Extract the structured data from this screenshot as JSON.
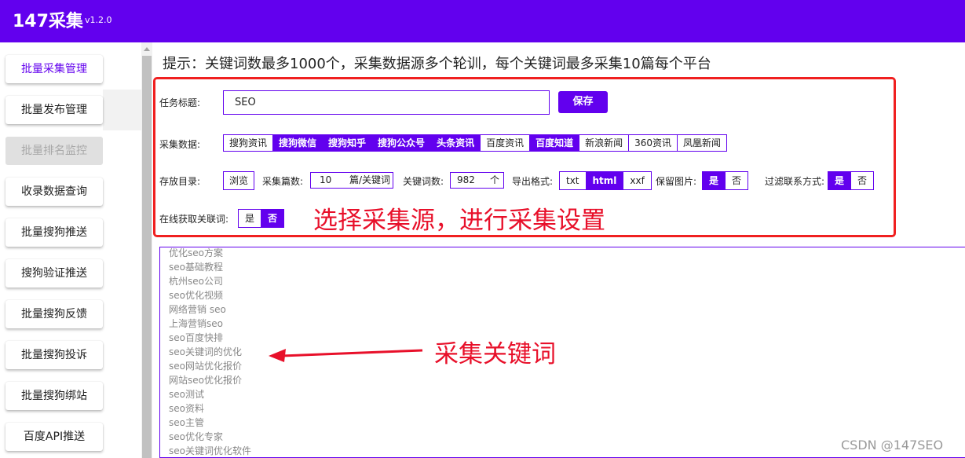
{
  "app": {
    "title": "147采集",
    "version": "v1.2.0"
  },
  "sidebar": {
    "items": [
      {
        "label": "批量采集管理",
        "state": "active"
      },
      {
        "label": "批量发布管理",
        "state": "normal"
      },
      {
        "label": "批量排名监控",
        "state": "disabled"
      },
      {
        "label": "收录数据查询",
        "state": "normal"
      },
      {
        "label": "批量搜狗推送",
        "state": "normal"
      },
      {
        "label": "搜狗验证推送",
        "state": "normal"
      },
      {
        "label": "批量搜狗反馈",
        "state": "normal"
      },
      {
        "label": "批量搜狗投诉",
        "state": "normal"
      },
      {
        "label": "批量搜狗绑站",
        "state": "normal"
      },
      {
        "label": "百度API推送",
        "state": "normal"
      }
    ]
  },
  "tip": "提示：关键词数最多1000个，采集数据源多个轮训，每个关键词最多采集10篇每个平台",
  "form": {
    "task_title_label": "任务标题:",
    "task_title_value": "SEO",
    "save_label": "保存",
    "source_label": "采集数据:",
    "sources": [
      {
        "label": "搜狗资讯",
        "on": false
      },
      {
        "label": "搜狗微信",
        "on": true
      },
      {
        "label": "搜狗知乎",
        "on": true
      },
      {
        "label": "搜狗公众号",
        "on": true
      },
      {
        "label": "头条资讯",
        "on": true
      },
      {
        "label": "百度资讯",
        "on": false
      },
      {
        "label": "百度知道",
        "on": true
      },
      {
        "label": "新浪新闻",
        "on": false
      },
      {
        "label": "360资讯",
        "on": false
      },
      {
        "label": "凤凰新闻",
        "on": false
      }
    ],
    "dir_label": "存放目录:",
    "browse_label": "浏览",
    "count_label": "采集篇数:",
    "count_value": "10",
    "count_unit": "篇/关键词",
    "kwcount_label": "关键词数:",
    "kwcount_value": "982",
    "kwcount_unit": "个",
    "format_label": "导出格式:",
    "formats": [
      {
        "label": "txt",
        "on": false
      },
      {
        "label": "html",
        "on": true
      },
      {
        "label": "xxf",
        "on": false
      }
    ],
    "keep_img_label": "保留图片:",
    "keep_img": [
      {
        "label": "是",
        "on": true
      },
      {
        "label": "否",
        "on": false
      }
    ],
    "filter_label": "过滤联系方式:",
    "filter": [
      {
        "label": "是",
        "on": true
      },
      {
        "label": "否",
        "on": false
      }
    ],
    "online_label": "在线获取关联词:",
    "online": [
      {
        "label": "是",
        "on": false
      },
      {
        "label": "否",
        "on": true
      }
    ]
  },
  "annotations": {
    "settings": "选择采集源，进行采集设置",
    "keywords": "采集关键词"
  },
  "keywords": [
    "优化seo方案",
    "seo基础教程",
    "杭州seo公司",
    "seo优化视频",
    "网络营销 seo",
    "上海营销seo",
    "seo百度快排",
    "seo关键词的优化",
    "seo网站优化报价",
    "网站seo优化报价",
    "seo测试",
    "seo资料",
    "seo主管",
    "seo优化专家",
    "seo关键词优化软件"
  ],
  "watermark": "CSDN @147SEO",
  "colors": {
    "accent": "#6200ee",
    "annotation": "#e8102a"
  }
}
